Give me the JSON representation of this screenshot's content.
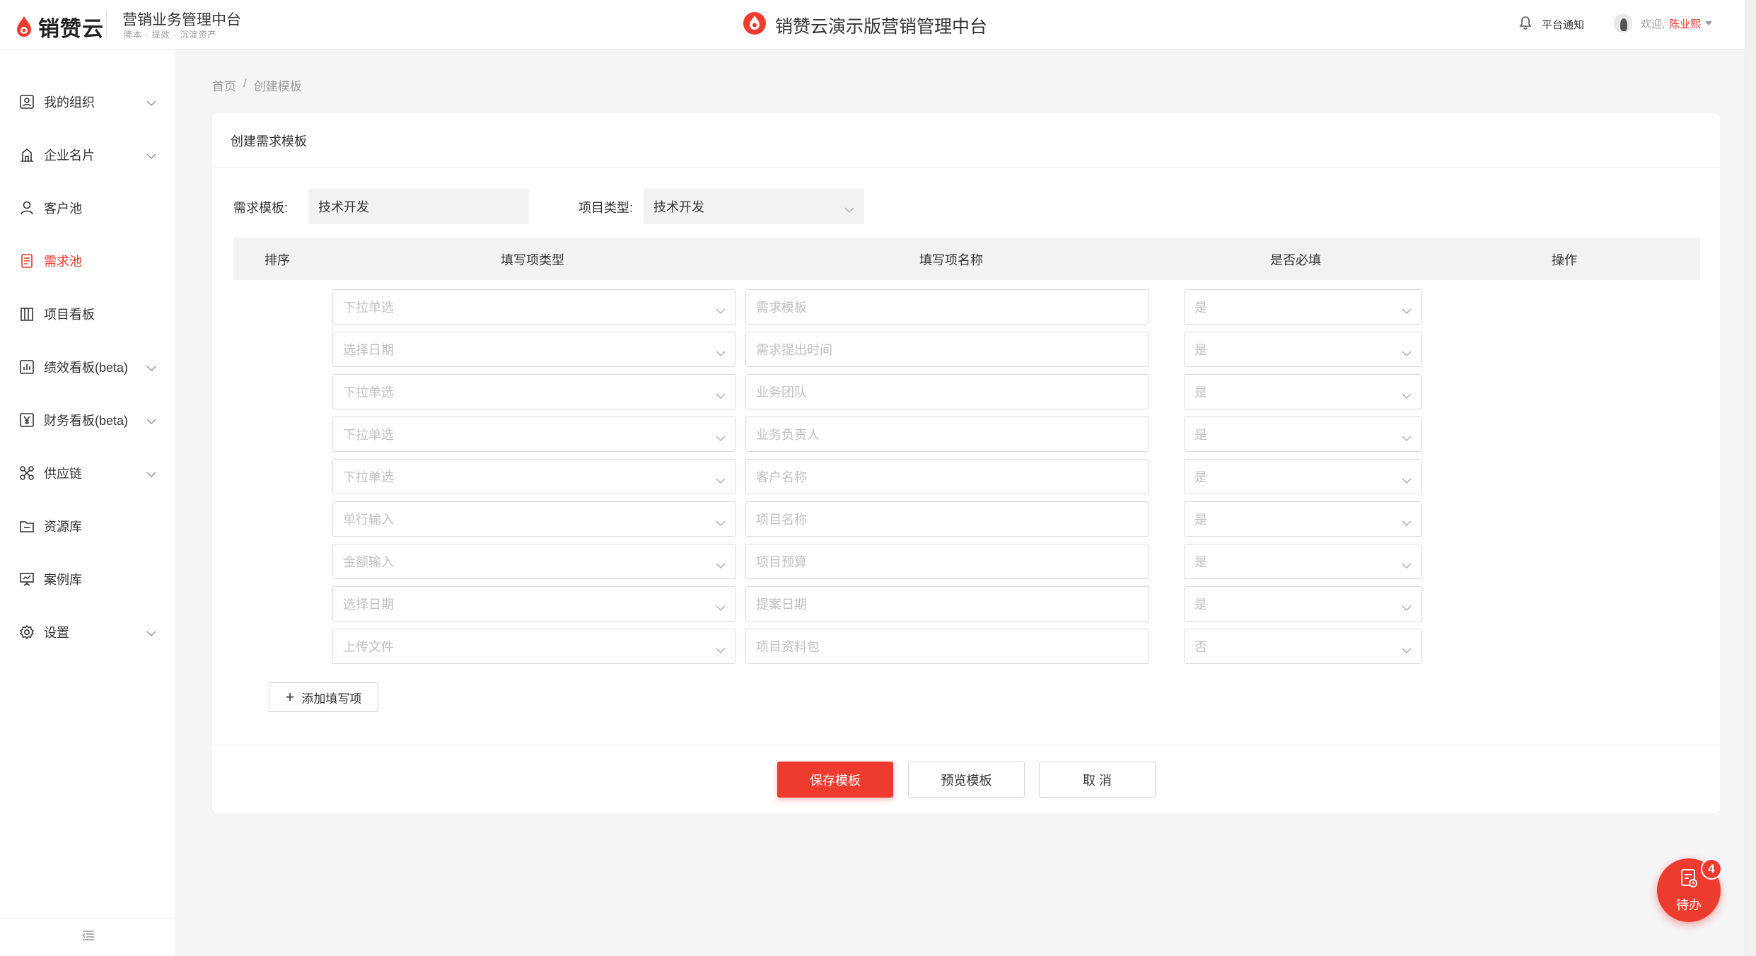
{
  "header": {
    "logo_text": "销赞云",
    "system_title": "营销业务管理中台",
    "system_subtitle": "降本 · 提效 · 沉淀资产",
    "center_title": "销赞云演示版营销管理中台",
    "notice_label": "平台通知",
    "welcome": "欢迎,",
    "user_name": "陈业熙"
  },
  "sidebar": {
    "items": [
      {
        "label": "我的组织",
        "icon": "org-icon",
        "chevron": true
      },
      {
        "label": "企业名片",
        "icon": "building-icon",
        "chevron": true
      },
      {
        "label": "客户池",
        "icon": "user-icon",
        "chevron": false
      },
      {
        "label": "需求池",
        "icon": "document-icon",
        "chevron": false,
        "active": true
      },
      {
        "label": "项目看板",
        "icon": "board-icon",
        "chevron": false
      },
      {
        "label": "绩效看板(beta)",
        "icon": "chart-icon",
        "chevron": true
      },
      {
        "label": "财务看板(beta)",
        "icon": "yen-icon",
        "chevron": true
      },
      {
        "label": "供应链",
        "icon": "network-icon",
        "chevron": true
      },
      {
        "label": "资源库",
        "icon": "folder-icon",
        "chevron": false
      },
      {
        "label": "案例库",
        "icon": "presentation-icon",
        "chevron": false
      },
      {
        "label": "设置",
        "icon": "gear-icon",
        "chevron": true
      }
    ]
  },
  "breadcrumb": {
    "home": "首页",
    "separator": "/",
    "current": "创建模板"
  },
  "card": {
    "title": "创建需求模板",
    "template_label": "需求模板:",
    "template_value": "技术开发",
    "project_type_label": "项目类型:",
    "project_type_value": "技术开发"
  },
  "table": {
    "headers": [
      "排序",
      "填写项类型",
      "填写项名称",
      "是否必填",
      "操作"
    ],
    "rows": [
      {
        "type": "下拉单选",
        "name": "需求模板",
        "required": "是"
      },
      {
        "type": "选择日期",
        "name": "需求提出时间",
        "required": "是"
      },
      {
        "type": "下拉单选",
        "name": "业务团队",
        "required": "是"
      },
      {
        "type": "下拉单选",
        "name": "业务负责人",
        "required": "是"
      },
      {
        "type": "下拉单选",
        "name": "客户名称",
        "required": "是"
      },
      {
        "type": "单行输入",
        "name": "项目名称",
        "required": "是"
      },
      {
        "type": "金额输入",
        "name": "项目预算",
        "required": "是"
      },
      {
        "type": "选择日期",
        "name": "提案日期",
        "required": "是"
      },
      {
        "type": "上传文件",
        "name": "项目资料包",
        "required": "否"
      }
    ]
  },
  "actions": {
    "add_item": "添加填写项",
    "save": "保存模板",
    "preview": "预览模板",
    "cancel": "取 消"
  },
  "todo": {
    "label": "待办",
    "count": "4"
  },
  "colors": {
    "accent": "#ee3b2f",
    "active_text": "#e8392c",
    "placeholder": "#c0c0c0"
  }
}
